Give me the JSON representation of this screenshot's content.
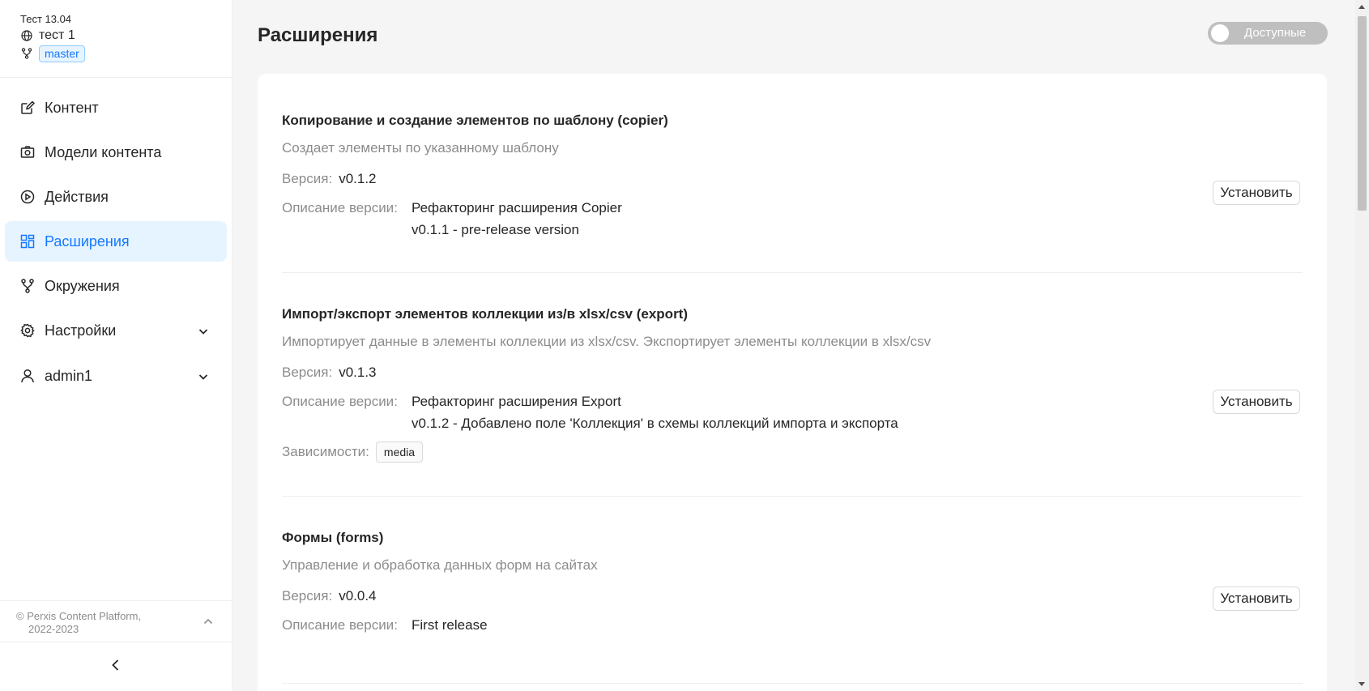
{
  "sidebar": {
    "org_name": "Тест 13.04",
    "space_name": "тест 1",
    "environment": "master",
    "menu": [
      {
        "label": "Контент",
        "icon": "edit-icon"
      },
      {
        "label": "Модели контента",
        "icon": "camera-box-icon"
      },
      {
        "label": "Действия",
        "icon": "play-circle-icon"
      },
      {
        "label": "Расширения",
        "icon": "extensions-grid-icon"
      },
      {
        "label": "Окружения",
        "icon": "branch-icon"
      },
      {
        "label": "Настройки",
        "icon": "gear-icon"
      }
    ],
    "active_item": "Расширения",
    "user": "admin1",
    "footer_line1": "© Perxis Content Platform,",
    "footer_line2": "2022-2023"
  },
  "page": {
    "title": "Расширения",
    "toggle_label": "Доступные"
  },
  "labels": {
    "version": "Версия",
    "version_description": "Описание версии",
    "dependencies": "Зависимости",
    "install": "Установить"
  },
  "extensions": [
    {
      "title": "Копирование и создание элементов по шаблону  (copier)",
      "description": "Создает элементы по указанному шаблону",
      "version": "v0.1.2",
      "version_notes": [
        "Рефакторинг расширения Copier",
        "v0.1.1 - pre-release version"
      ],
      "dependencies": []
    },
    {
      "title": "Импорт/экспорт элементов коллекции из/в xlsx/csv  (export)",
      "description": "Импортирует данные в элементы коллекции из xlsx/csv. Экспортирует элементы коллекции в xlsx/csv",
      "version": "v0.1.3",
      "version_notes": [
        "Рефакторинг расширения Export",
        "v0.1.2 - Добавлено поле 'Коллекция' в схемы коллекций импорта и экспорта"
      ],
      "dependencies": [
        "media"
      ]
    },
    {
      "title": "Формы  (forms)",
      "description": "Управление и обработка данных форм на сайтах",
      "version": "v0.0.4",
      "version_notes": [
        "First release"
      ],
      "dependencies": []
    }
  ],
  "colors": {
    "accent": "#1677ff",
    "active_bg": "#e6f4ff",
    "muted_text": "#8c8c8c"
  }
}
